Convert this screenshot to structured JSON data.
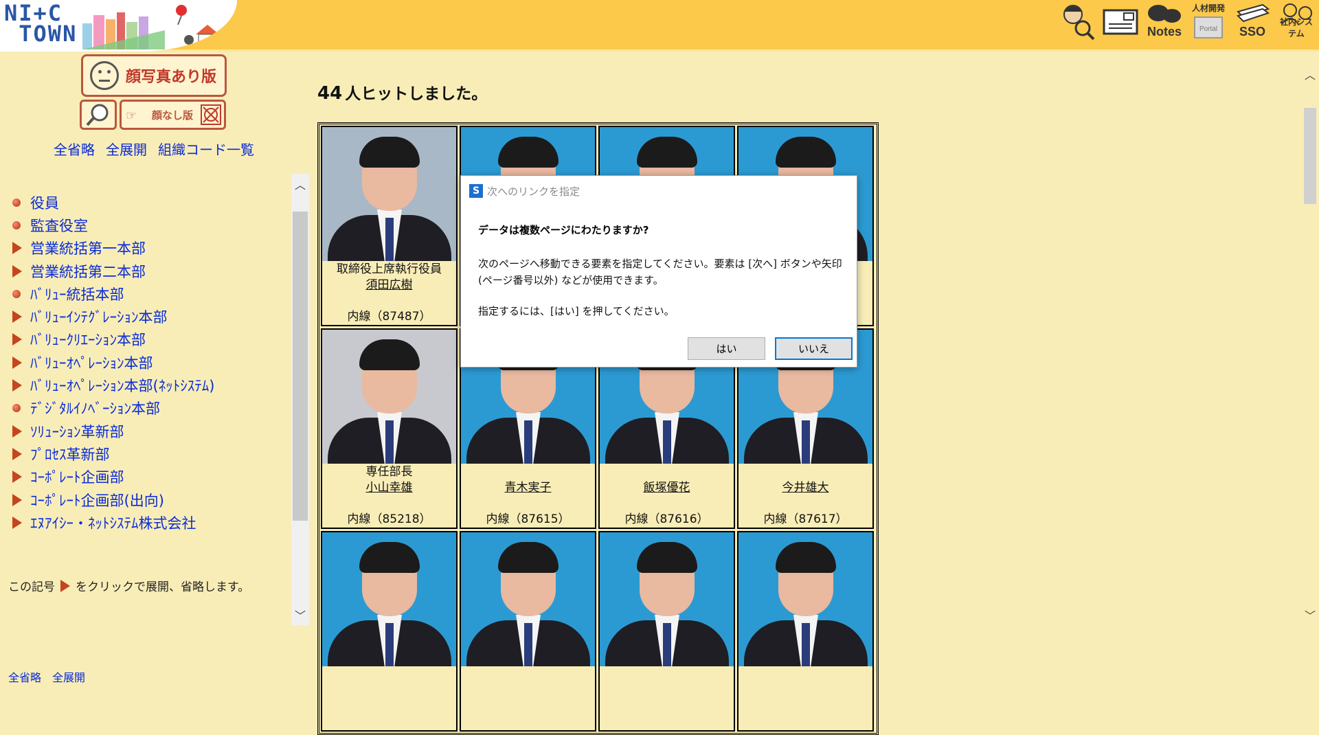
{
  "header": {
    "logo_text": "NI+C\n TOWN",
    "icons": [
      {
        "name": "people-search-icon",
        "label": ""
      },
      {
        "name": "mail-icon",
        "label": ""
      },
      {
        "name": "notes-icon",
        "label": "Notes"
      },
      {
        "name": "portal-site-icon",
        "label": "人材開発"
      },
      {
        "name": "sso-icon",
        "label": "SSO"
      },
      {
        "name": "internal-system-qa-icon",
        "label": "社内システム"
      }
    ]
  },
  "sidebar": {
    "face_version_label": "顔写真あり版",
    "noface_version_label": "顔なし版",
    "links": [
      "全省略",
      "全展開",
      "組織コード一覧"
    ],
    "tree": [
      {
        "label": "役員",
        "type": "leaf"
      },
      {
        "label": "監査役室",
        "type": "leaf"
      },
      {
        "label": "営業統括第一本部",
        "type": "branch"
      },
      {
        "label": "営業統括第二本部",
        "type": "branch"
      },
      {
        "label": "ﾊﾞﾘｭｰ統括本部",
        "type": "leaf"
      },
      {
        "label": "ﾊﾞﾘｭｰｲﾝﾃｸﾞﾚｰｼｮﾝ本部",
        "type": "branch"
      },
      {
        "label": "ﾊﾞﾘｭｰｸﾘｴｰｼｮﾝ本部",
        "type": "branch"
      },
      {
        "label": "ﾊﾞﾘｭｰｵﾍﾟﾚｰｼｮﾝ本部",
        "type": "branch"
      },
      {
        "label": "ﾊﾞﾘｭｰｵﾍﾟﾚｰｼｮﾝ本部(ﾈｯﾄｼｽﾃﾑ)",
        "type": "branch"
      },
      {
        "label": "ﾃﾞｼﾞﾀﾙｲﾉﾍﾞｰｼｮﾝ本部",
        "type": "leaf"
      },
      {
        "label": "ｿﾘｭｰｼｮﾝ革新部",
        "type": "branch"
      },
      {
        "label": "ﾌﾟﾛｾｽ革新部",
        "type": "branch"
      },
      {
        "label": "ｺｰﾎﾟﾚｰﾄ企画部",
        "type": "branch"
      },
      {
        "label": "ｺｰﾎﾟﾚｰﾄ企画部(出向)",
        "type": "branch"
      },
      {
        "label": "ｴﾇｱｲｼｰ・ﾈｯﾄｼｽﾃﾑ株式会社",
        "type": "branch"
      }
    ],
    "hint_prefix": "この記号",
    "hint_suffix": "をクリックで展開、省略します。",
    "bottom_links": "全省略　全展開"
  },
  "main": {
    "hit_count": "44",
    "hit_text": "人ヒットしました。",
    "people": [
      {
        "role": "取締役上席執行役員",
        "name": "須田広樹",
        "ext": "内線（87487）",
        "photo": "gray-blue",
        "hair": true
      },
      {
        "role": "",
        "name": "",
        "ext": "",
        "photo": "blue",
        "hair": true
      },
      {
        "role": "",
        "name": "",
        "ext": "",
        "photo": "blue",
        "hair": true
      },
      {
        "role": "",
        "name": "",
        "ext": "",
        "photo": "blue",
        "hair": true
      },
      {
        "role": "専任部長",
        "name": "小山幸雄",
        "ext": "内線（85218）",
        "photo": "gray",
        "hair": true
      },
      {
        "role": "",
        "name": "青木実子",
        "ext": "内線（87615）",
        "photo": "blue",
        "hair": true
      },
      {
        "role": "",
        "name": "飯塚優花",
        "ext": "内線（87616）",
        "photo": "blue",
        "hair": true
      },
      {
        "role": "",
        "name": "今井雄大",
        "ext": "内線（87617）",
        "photo": "blue",
        "hair": true
      },
      {
        "role": "",
        "name": "",
        "ext": "",
        "photo": "blue",
        "hair": true
      },
      {
        "role": "",
        "name": "",
        "ext": "",
        "photo": "blue",
        "hair": true
      },
      {
        "role": "",
        "name": "",
        "ext": "",
        "photo": "blue",
        "hair": true
      },
      {
        "role": "",
        "name": "",
        "ext": "",
        "photo": "blue",
        "hair": true
      }
    ]
  },
  "dialog": {
    "title": "次へのリンクを指定",
    "question": "データは複数ページにわたりますか?",
    "body": "次のページへ移動できる要素を指定してください。要素は [次へ] ボタンや矢印 (ページ番号以外) などが使用できます。",
    "instruction": "指定するには、[はい] を押してください。",
    "yes_label": "はい",
    "no_label": "いいえ"
  },
  "colors": {
    "banner": "#fcc94a",
    "background": "#f8edb7",
    "link": "#0a2bd8",
    "accent": "#c4451e",
    "photo_bg": "#2c9ad2"
  }
}
